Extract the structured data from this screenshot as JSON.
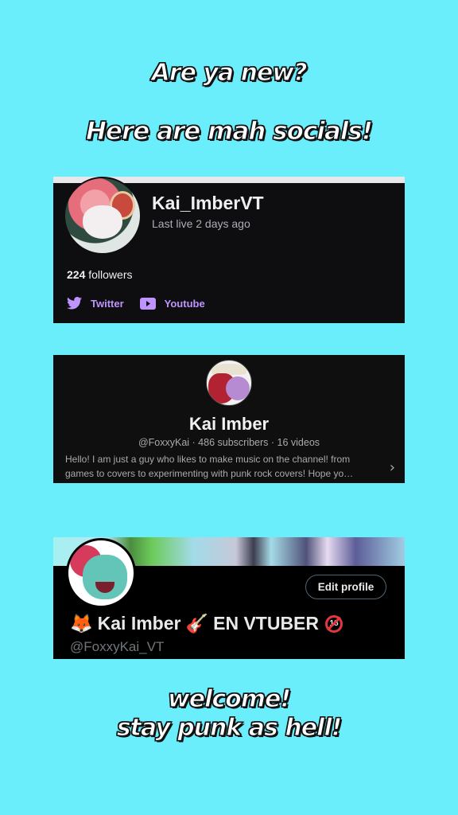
{
  "header": {
    "line1": "Are ya new?",
    "line2": "Here are mah socials!"
  },
  "twitch": {
    "name": "Kai_ImberVT",
    "last_live": "Last live 2 days ago",
    "followers_count": "224",
    "followers_label": " followers",
    "links": [
      {
        "label": "Twitter",
        "icon": "twitter-bird-icon"
      },
      {
        "label": "Youtube",
        "icon": "youtube-play-icon"
      }
    ],
    "accent": "#bf94ff"
  },
  "youtube": {
    "name": "Kai Imber",
    "meta": "@FoxxyKai · 486 subscribers · 16 videos",
    "description_line1": "Hello! I am just a guy who likes to make music on the channel! from",
    "description_line2": "games to covers to experimenting with punk rock covers! Hope yo…",
    "chevron": "›"
  },
  "twitter": {
    "edit_button": "Edit profile",
    "name_prefix_emoji": "🦊",
    "name": "Kai Imber",
    "guitar_emoji": "🎸",
    "name_suffix": "EN VTUBER",
    "age_badge": "18",
    "handle": "@FoxxyKai_VT"
  },
  "footer": {
    "line1": "welcome!",
    "line2": "stay punk as hell!"
  },
  "colors": {
    "background": "#6aeefc",
    "twitch_card": "#0e0e10",
    "youtube_card": "#0f0f0f",
    "twitter_card": "#000000"
  }
}
